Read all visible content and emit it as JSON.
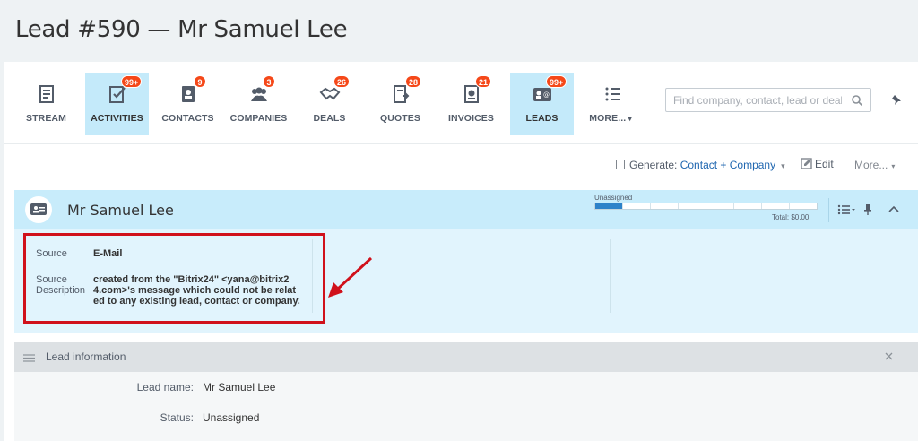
{
  "page": {
    "title": "Lead #590 — Mr Samuel Lee"
  },
  "toolbar": {
    "items": [
      {
        "label": "STREAM",
        "badge": "",
        "icon": "stream-icon",
        "active": false
      },
      {
        "label": "ACTIVITIES",
        "badge": "99+",
        "icon": "activities-icon",
        "active": true
      },
      {
        "label": "CONTACTS",
        "badge": "9",
        "icon": "contacts-icon",
        "active": false
      },
      {
        "label": "COMPANIES",
        "badge": "3",
        "icon": "companies-icon",
        "active": false
      },
      {
        "label": "DEALS",
        "badge": "26",
        "icon": "deals-icon",
        "active": false
      },
      {
        "label": "QUOTES",
        "badge": "28",
        "icon": "quotes-icon",
        "active": false
      },
      {
        "label": "INVOICES",
        "badge": "21",
        "icon": "invoices-icon",
        "active": false
      },
      {
        "label": "LEADS",
        "badge": "99+",
        "icon": "leads-icon",
        "active": true
      },
      {
        "label": "MORE...",
        "badge": "",
        "icon": "more-list-icon",
        "active": false
      }
    ],
    "search_placeholder": "Find company, contact, lead or deal."
  },
  "actions": {
    "generate_label": "Generate:",
    "generate_value": "Contact + Company",
    "edit_label": "Edit",
    "more_label": "More..."
  },
  "lead": {
    "name": "Mr Samuel Lee",
    "status": "Unassigned",
    "total": "Total: $0.00",
    "progress_done_fraction": 0.1
  },
  "source": {
    "source_label": "Source",
    "source_value": "E-Mail",
    "desc_label_1": "Source",
    "desc_label_2": "Description",
    "desc_line_1": "created from the \"Bitrix24\" <yana@bitrix2",
    "desc_line_2": "4.com>'s message which could not be relat",
    "desc_line_3": "ed to any existing lead, contact or company."
  },
  "info": {
    "title": "Lead information",
    "rows": [
      {
        "label": "Lead name:",
        "value": "Mr Samuel Lee"
      },
      {
        "label": "Status:",
        "value": "Unassigned"
      }
    ]
  },
  "colors": {
    "accent": "#2067b0",
    "badge": "#f54819",
    "active_tab": "#c4eafa",
    "highlight": "#d0111b"
  }
}
